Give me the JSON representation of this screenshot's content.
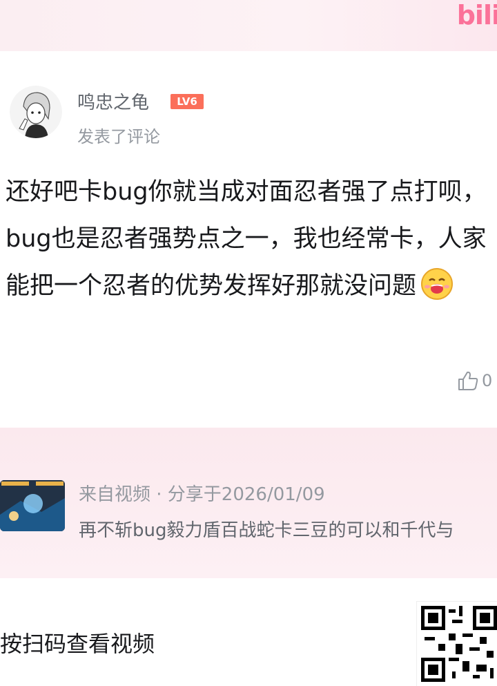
{
  "brand": "bili",
  "author": {
    "name": "鸣忠之龟",
    "level": "LV6",
    "action": "发表了评论"
  },
  "comment": {
    "text": "还好吧卡bug你就当成对面忍者强了点打呗，bug也是忍者强势点之一，我也经常卡，人家能把一个忍者的优势发挥好那就没问题",
    "likes": "0"
  },
  "video": {
    "source": "来自视频 · 分享于2026/01/09",
    "title": "再不斩bug毅力盾百战蛇卡三豆的可以和千代与"
  },
  "footer": {
    "scan_text": "按扫码查看视频"
  },
  "colors": {
    "accent": "#fb7299",
    "level_badge": "#fb6f5a"
  }
}
